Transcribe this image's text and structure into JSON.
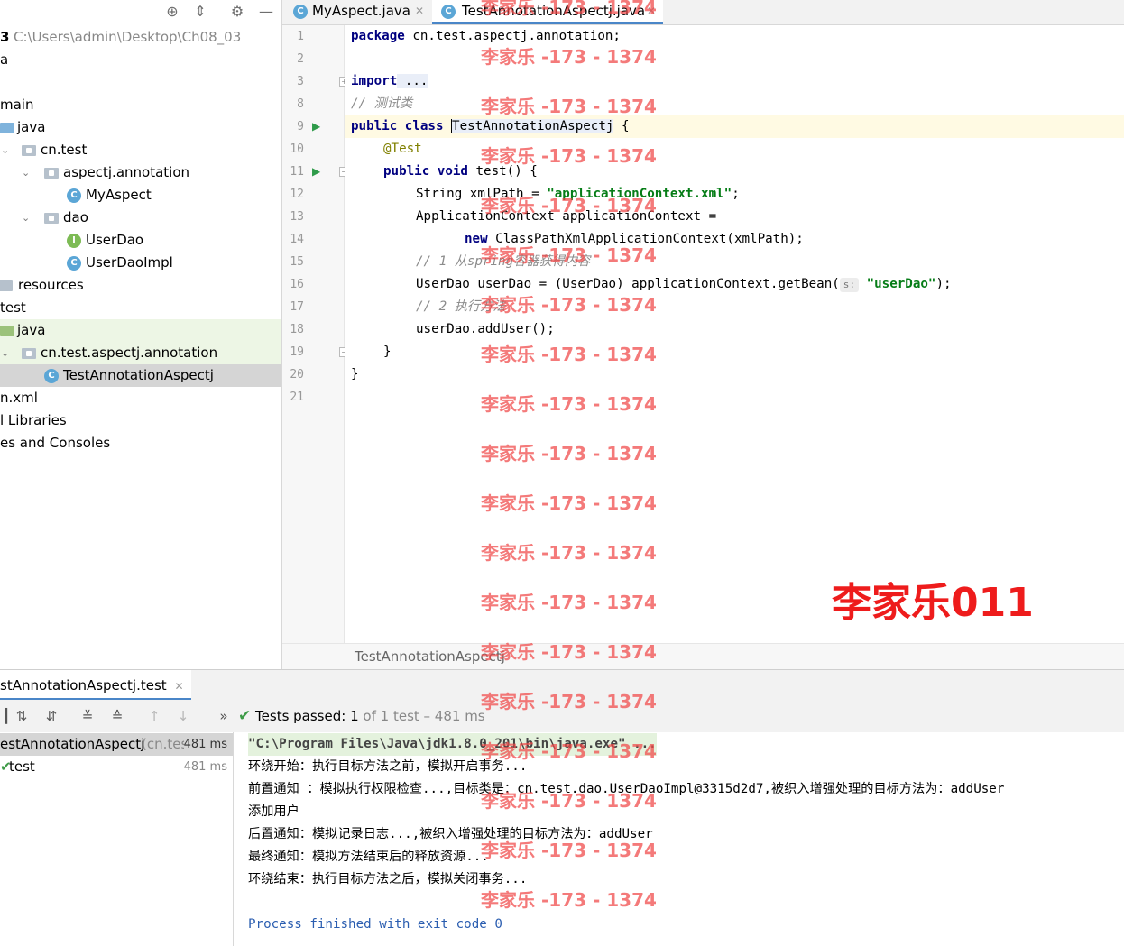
{
  "project_tree": {
    "project_root": "3",
    "project_path": "C:\\Users\\admin\\Desktop\\Ch08_03",
    "items": [
      {
        "label": "a"
      },
      {
        "label": ""
      },
      {
        "label": "main"
      },
      {
        "label": "java"
      },
      {
        "label": "cn.test"
      },
      {
        "label": "aspectj.annotation"
      },
      {
        "label": "MyAspect"
      },
      {
        "label": "dao"
      },
      {
        "label": "UserDao"
      },
      {
        "label": "UserDaoImpl"
      },
      {
        "label": "resources"
      },
      {
        "label": "test"
      },
      {
        "label": "java"
      },
      {
        "label": "cn.test.aspectj.annotation"
      },
      {
        "label": "TestAnnotationAspectj"
      },
      {
        "label": "n.xml"
      },
      {
        "label": "l Libraries"
      },
      {
        "label": "es and Consoles"
      }
    ]
  },
  "editor": {
    "tabs": [
      {
        "label": "MyAspect.java"
      },
      {
        "label": "TestAnnotationAspectj.java"
      }
    ],
    "line_numbers": [
      "1",
      "2",
      "3",
      "8",
      "9",
      "10",
      "11",
      "12",
      "13",
      "14",
      "15",
      "16",
      "17",
      "18",
      "19",
      "20",
      "21"
    ],
    "code": {
      "l1_kw": "package",
      "l1_rest": " cn.test.aspectj.annotation;",
      "l3_kw": "import",
      "l3_rest": " ...",
      "l8": "// 测试类",
      "l9_kw": "public class",
      "l9_name": "TestAnnotationAspectj",
      "l9_rest": " {",
      "l10": "@Test",
      "l11_kw": "public void",
      "l11_rest": " test() {",
      "l12_a": "String xmlPath = ",
      "l12_str": "\"applicationContext.xml\"",
      "l12_b": ";",
      "l13": "ApplicationContext applicationContext =",
      "l14_kw": "new",
      "l14_rest": " ClassPathXmlApplicationContext(xmlPath);",
      "l15": "// 1 从spring容器获得内容",
      "l16_a": "UserDao userDao = (UserDao) applicationContext.getBean(",
      "l16_hint": "s:",
      "l16_str": "\"userDao\"",
      "l16_b": ");",
      "l17": "// 2 执行方法",
      "l18": "userDao.addUser();",
      "l19": "}",
      "l20": "}"
    },
    "breadcrumb": "TestAnnotationAspectj"
  },
  "run_panel": {
    "tab_label": "stAnnotationAspectj.test",
    "status_label": "Tests passed:",
    "status_count": "1",
    "status_rest": "of 1 test – 481 ms",
    "test_tree": [
      {
        "label": "estAnnotationAspectj",
        "suffix": "(cn.tes",
        "time": "481 ms"
      },
      {
        "label": "test",
        "time": "481 ms"
      }
    ],
    "console": [
      "\"C:\\Program Files\\Java\\jdk1.8.0_201\\bin\\java.exe\" ...",
      "环绕开始：执行目标方法之前，模拟开启事务...",
      "前置通知 ：模拟执行权限检查...,目标类是：cn.test.dao.UserDaoImpl@3315d2d7,被织入增强处理的目标方法为：addUser",
      "添加用户",
      "后置通知：模拟记录日志...,被织入增强处理的目标方法为：addUser",
      "最终通知：模拟方法结束后的释放资源...",
      "环绕结束：执行目标方法之后，模拟关闭事务...",
      "",
      "Process finished with exit code 0"
    ]
  },
  "watermark": {
    "repeat_text": "李家乐 -173 - 1374",
    "big_text": "李家乐011"
  },
  "colors": {
    "keyword": "#000080",
    "string": "#067d17",
    "comment": "#8c8c8c",
    "annotation": "#808000",
    "selection_bar": "#4a86c8",
    "watermark": "#ee1c1c",
    "pass_check": "#3d9b47"
  }
}
